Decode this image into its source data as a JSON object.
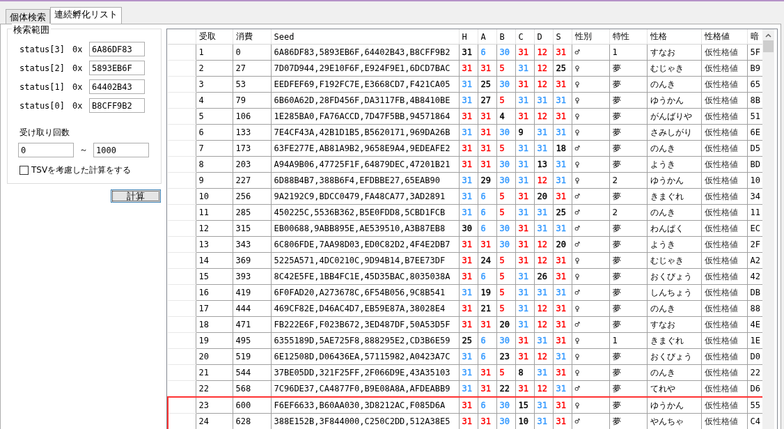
{
  "tabs": [
    {
      "label": "個体検索",
      "selected": false
    },
    {
      "label": "連続孵化リスト",
      "selected": true
    }
  ],
  "search_range": {
    "title": "検索範囲",
    "status_fields": [
      {
        "label": "status[3]",
        "prefix": "0x",
        "value": "6A86DF83"
      },
      {
        "label": "status[2]",
        "prefix": "0x",
        "value": "5893EB6F"
      },
      {
        "label": "status[1]",
        "prefix": "0x",
        "value": "64402B43"
      },
      {
        "label": "status[0]",
        "prefix": "0x",
        "value": "B8CFF9B2"
      }
    ],
    "count_label": "受け取り回数",
    "range_from": "0",
    "range_separator": "～",
    "range_to": "1000",
    "tsv_checkbox": {
      "label": "TSVを考慮した計算をする",
      "checked": false
    }
  },
  "calculate_button": "計算",
  "table": {
    "columns": [
      "受取",
      "消費",
      "Seed",
      "H",
      "A",
      "B",
      "C",
      "D",
      "S",
      "性別",
      "特性",
      "性格",
      "性格値",
      "暗"
    ],
    "rows": [
      {
        "receive": "1",
        "consume": "0",
        "seed": "6A86DF83,5893EB6F,64402B43,B8CFF9B2",
        "ivs": [
          {
            "value": "31",
            "color": "#000000"
          },
          {
            "value": "6",
            "color": "#3399ff"
          },
          {
            "value": "30",
            "color": "#3399ff"
          },
          {
            "value": "31",
            "color": "#ff0000"
          },
          {
            "value": "12",
            "color": "#ff0000"
          },
          {
            "value": "31",
            "color": "#ff0000"
          }
        ],
        "gender": "♂",
        "ability": "1",
        "nature": "すなお",
        "pid": "仮性格値",
        "column_14": "5F",
        "marked": false
      },
      {
        "receive": "2",
        "consume": "27",
        "seed": "7D07D944,29E10F6F,E924F9E1,6DCD7BAC",
        "ivs": [
          {
            "value": "31",
            "color": "#ff0000"
          },
          {
            "value": "31",
            "color": "#ff0000"
          },
          {
            "value": "5",
            "color": "#ff0000"
          },
          {
            "value": "31",
            "color": "#3399ff"
          },
          {
            "value": "12",
            "color": "#ff0000"
          },
          {
            "value": "25",
            "color": "#000000"
          }
        ],
        "gender": "♀",
        "ability": "夢",
        "nature": "むじゃき",
        "pid": "仮性格値",
        "column_14": "B9",
        "marked": false
      },
      {
        "receive": "3",
        "consume": "53",
        "seed": "EEDFEF69,F192FC7E,E3668CD7,F421CA05",
        "ivs": [
          {
            "value": "31",
            "color": "#3399ff"
          },
          {
            "value": "25",
            "color": "#000000"
          },
          {
            "value": "30",
            "color": "#3399ff"
          },
          {
            "value": "31",
            "color": "#ff0000"
          },
          {
            "value": "12",
            "color": "#ff0000"
          },
          {
            "value": "31",
            "color": "#ff0000"
          }
        ],
        "gender": "♀",
        "ability": "夢",
        "nature": "のんき",
        "pid": "仮性格値",
        "column_14": "65",
        "marked": false
      },
      {
        "receive": "4",
        "consume": "79",
        "seed": "6B60A62D,28FD456F,DA3117FB,4B8410BE",
        "ivs": [
          {
            "value": "31",
            "color": "#3399ff"
          },
          {
            "value": "27",
            "color": "#000000"
          },
          {
            "value": "5",
            "color": "#ff0000"
          },
          {
            "value": "31",
            "color": "#3399ff"
          },
          {
            "value": "31",
            "color": "#3399ff"
          },
          {
            "value": "31",
            "color": "#3399ff"
          }
        ],
        "gender": "♀",
        "ability": "夢",
        "nature": "ゆうかん",
        "pid": "仮性格値",
        "column_14": "8B",
        "marked": false
      },
      {
        "receive": "5",
        "consume": "106",
        "seed": "1E285BA0,FA76ACCD,7D47F5BB,94571864",
        "ivs": [
          {
            "value": "31",
            "color": "#ff0000"
          },
          {
            "value": "31",
            "color": "#ff0000"
          },
          {
            "value": "4",
            "color": "#000000"
          },
          {
            "value": "31",
            "color": "#ff0000"
          },
          {
            "value": "12",
            "color": "#ff0000"
          },
          {
            "value": "31",
            "color": "#ff0000"
          }
        ],
        "gender": "♀",
        "ability": "夢",
        "nature": "がんばりや",
        "pid": "仮性格値",
        "column_14": "51",
        "marked": false
      },
      {
        "receive": "6",
        "consume": "133",
        "seed": "7E4CF43A,42B1D1B5,B5620171,969DA26B",
        "ivs": [
          {
            "value": "31",
            "color": "#3399ff"
          },
          {
            "value": "31",
            "color": "#ff0000"
          },
          {
            "value": "30",
            "color": "#3399ff"
          },
          {
            "value": "9",
            "color": "#000000"
          },
          {
            "value": "31",
            "color": "#3399ff"
          },
          {
            "value": "31",
            "color": "#3399ff"
          }
        ],
        "gender": "♀",
        "ability": "夢",
        "nature": "さみしがり",
        "pid": "仮性格値",
        "column_14": "6E",
        "marked": false
      },
      {
        "receive": "7",
        "consume": "173",
        "seed": "63FE277E,AB81A9B2,9658E9A4,9EDEAFE2",
        "ivs": [
          {
            "value": "31",
            "color": "#ff0000"
          },
          {
            "value": "31",
            "color": "#ff0000"
          },
          {
            "value": "5",
            "color": "#ff0000"
          },
          {
            "value": "31",
            "color": "#3399ff"
          },
          {
            "value": "31",
            "color": "#3399ff"
          },
          {
            "value": "18",
            "color": "#000000"
          }
        ],
        "gender": "♂",
        "ability": "夢",
        "nature": "のんき",
        "pid": "仮性格値",
        "column_14": "D5",
        "marked": false
      },
      {
        "receive": "8",
        "consume": "203",
        "seed": "A94A9B06,47725F1F,64879DEC,47201B21",
        "ivs": [
          {
            "value": "31",
            "color": "#ff0000"
          },
          {
            "value": "31",
            "color": "#ff0000"
          },
          {
            "value": "30",
            "color": "#3399ff"
          },
          {
            "value": "31",
            "color": "#3399ff"
          },
          {
            "value": "13",
            "color": "#000000"
          },
          {
            "value": "31",
            "color": "#3399ff"
          }
        ],
        "gender": "♀",
        "ability": "夢",
        "nature": "ようき",
        "pid": "仮性格値",
        "column_14": "BD",
        "marked": false
      },
      {
        "receive": "9",
        "consume": "227",
        "seed": "6D88B4B7,388B6F4,EFDBBE27,65EAB90",
        "ivs": [
          {
            "value": "31",
            "color": "#3399ff"
          },
          {
            "value": "29",
            "color": "#000000"
          },
          {
            "value": "30",
            "color": "#3399ff"
          },
          {
            "value": "31",
            "color": "#3399ff"
          },
          {
            "value": "12",
            "color": "#ff0000"
          },
          {
            "value": "31",
            "color": "#3399ff"
          }
        ],
        "gender": "♀",
        "ability": "2",
        "nature": "ゆうかん",
        "pid": "仮性格値",
        "column_14": "10",
        "marked": false
      },
      {
        "receive": "10",
        "consume": "256",
        "seed": "9A2192C9,BDCC0479,FA48CA77,3AD2891",
        "ivs": [
          {
            "value": "31",
            "color": "#3399ff"
          },
          {
            "value": "6",
            "color": "#3399ff"
          },
          {
            "value": "5",
            "color": "#ff0000"
          },
          {
            "value": "31",
            "color": "#ff0000"
          },
          {
            "value": "20",
            "color": "#000000"
          },
          {
            "value": "31",
            "color": "#ff0000"
          }
        ],
        "gender": "♂",
        "ability": "夢",
        "nature": "きまぐれ",
        "pid": "仮性格値",
        "column_14": "34",
        "marked": false
      },
      {
        "receive": "11",
        "consume": "285",
        "seed": "450225C,5536B362,B5E0FDD8,5CBD1FCB",
        "ivs": [
          {
            "value": "31",
            "color": "#3399ff"
          },
          {
            "value": "6",
            "color": "#3399ff"
          },
          {
            "value": "5",
            "color": "#ff0000"
          },
          {
            "value": "31",
            "color": "#3399ff"
          },
          {
            "value": "31",
            "color": "#3399ff"
          },
          {
            "value": "25",
            "color": "#000000"
          }
        ],
        "gender": "♂",
        "ability": "2",
        "nature": "のんき",
        "pid": "仮性格値",
        "column_14": "11",
        "marked": false
      },
      {
        "receive": "12",
        "consume": "315",
        "seed": "EB00688,9ABB895E,AE539510,A3B87EB8",
        "ivs": [
          {
            "value": "30",
            "color": "#000000"
          },
          {
            "value": "6",
            "color": "#3399ff"
          },
          {
            "value": "30",
            "color": "#3399ff"
          },
          {
            "value": "31",
            "color": "#ff0000"
          },
          {
            "value": "31",
            "color": "#3399ff"
          },
          {
            "value": "31",
            "color": "#3399ff"
          }
        ],
        "gender": "♂",
        "ability": "夢",
        "nature": "わんぱく",
        "pid": "仮性格値",
        "column_14": "EC",
        "marked": false
      },
      {
        "receive": "13",
        "consume": "343",
        "seed": "6C806FDE,7AA98D03,ED0C82D2,4F4E2DB7",
        "ivs": [
          {
            "value": "31",
            "color": "#ff0000"
          },
          {
            "value": "31",
            "color": "#ff0000"
          },
          {
            "value": "30",
            "color": "#3399ff"
          },
          {
            "value": "31",
            "color": "#ff0000"
          },
          {
            "value": "12",
            "color": "#ff0000"
          },
          {
            "value": "20",
            "color": "#000000"
          }
        ],
        "gender": "♂",
        "ability": "夢",
        "nature": "ようき",
        "pid": "仮性格値",
        "column_14": "2F",
        "marked": false
      },
      {
        "receive": "14",
        "consume": "369",
        "seed": "5225A571,4DC0210C,9D94B14,B7EE73DF",
        "ivs": [
          {
            "value": "31",
            "color": "#ff0000"
          },
          {
            "value": "24",
            "color": "#000000"
          },
          {
            "value": "5",
            "color": "#ff0000"
          },
          {
            "value": "31",
            "color": "#ff0000"
          },
          {
            "value": "12",
            "color": "#ff0000"
          },
          {
            "value": "31",
            "color": "#ff0000"
          }
        ],
        "gender": "♀",
        "ability": "夢",
        "nature": "むじゃき",
        "pid": "仮性格値",
        "column_14": "A2",
        "marked": false
      },
      {
        "receive": "15",
        "consume": "393",
        "seed": "8C42E5FE,1BB4FC1E,45D35BAC,8035038A",
        "ivs": [
          {
            "value": "31",
            "color": "#ff0000"
          },
          {
            "value": "6",
            "color": "#3399ff"
          },
          {
            "value": "5",
            "color": "#ff0000"
          },
          {
            "value": "31",
            "color": "#3399ff"
          },
          {
            "value": "26",
            "color": "#000000"
          },
          {
            "value": "31",
            "color": "#ff0000"
          }
        ],
        "gender": "♀",
        "ability": "夢",
        "nature": "おくびょう",
        "pid": "仮性格値",
        "column_14": "42",
        "marked": false
      },
      {
        "receive": "16",
        "consume": "419",
        "seed": "6F0FAD20,A273678C,6F54B056,9C8B541",
        "ivs": [
          {
            "value": "31",
            "color": "#3399ff"
          },
          {
            "value": "19",
            "color": "#000000"
          },
          {
            "value": "5",
            "color": "#ff0000"
          },
          {
            "value": "31",
            "color": "#3399ff"
          },
          {
            "value": "31",
            "color": "#3399ff"
          },
          {
            "value": "31",
            "color": "#3399ff"
          }
        ],
        "gender": "♂",
        "ability": "夢",
        "nature": "しんちょう",
        "pid": "仮性格値",
        "column_14": "DB",
        "marked": false
      },
      {
        "receive": "17",
        "consume": "444",
        "seed": "469CF82E,D46AC4D7,EB59E87A,38028E4",
        "ivs": [
          {
            "value": "31",
            "color": "#ff0000"
          },
          {
            "value": "21",
            "color": "#000000"
          },
          {
            "value": "5",
            "color": "#ff0000"
          },
          {
            "value": "31",
            "color": "#3399ff"
          },
          {
            "value": "12",
            "color": "#ff0000"
          },
          {
            "value": "31",
            "color": "#ff0000"
          }
        ],
        "gender": "♀",
        "ability": "夢",
        "nature": "のんき",
        "pid": "仮性格値",
        "column_14": "88",
        "marked": false
      },
      {
        "receive": "18",
        "consume": "471",
        "seed": "FB222E6F,F023B672,3ED487DF,50A53D5F",
        "ivs": [
          {
            "value": "31",
            "color": "#ff0000"
          },
          {
            "value": "31",
            "color": "#ff0000"
          },
          {
            "value": "20",
            "color": "#000000"
          },
          {
            "value": "31",
            "color": "#3399ff"
          },
          {
            "value": "12",
            "color": "#ff0000"
          },
          {
            "value": "31",
            "color": "#ff0000"
          }
        ],
        "gender": "♂",
        "ability": "夢",
        "nature": "すなお",
        "pid": "仮性格値",
        "column_14": "4E",
        "marked": false
      },
      {
        "receive": "19",
        "consume": "495",
        "seed": "6355189D,5AE725F8,888295E2,CD3B6E59",
        "ivs": [
          {
            "value": "25",
            "color": "#000000"
          },
          {
            "value": "6",
            "color": "#3399ff"
          },
          {
            "value": "30",
            "color": "#3399ff"
          },
          {
            "value": "31",
            "color": "#ff0000"
          },
          {
            "value": "31",
            "color": "#3399ff"
          },
          {
            "value": "31",
            "color": "#ff0000"
          }
        ],
        "gender": "♀",
        "ability": "1",
        "nature": "きまぐれ",
        "pid": "仮性格値",
        "column_14": "1E",
        "marked": false
      },
      {
        "receive": "20",
        "consume": "519",
        "seed": "6E12508D,D06436EA,57115982,A0423A7C",
        "ivs": [
          {
            "value": "31",
            "color": "#3399ff"
          },
          {
            "value": "6",
            "color": "#3399ff"
          },
          {
            "value": "23",
            "color": "#000000"
          },
          {
            "value": "31",
            "color": "#ff0000"
          },
          {
            "value": "12",
            "color": "#ff0000"
          },
          {
            "value": "31",
            "color": "#3399ff"
          }
        ],
        "gender": "♀",
        "ability": "夢",
        "nature": "おくびょう",
        "pid": "仮性格値",
        "column_14": "D0",
        "marked": false
      },
      {
        "receive": "21",
        "consume": "544",
        "seed": "37BE05DD,321F25FF,2F066D9E,43A35103",
        "ivs": [
          {
            "value": "31",
            "color": "#3399ff"
          },
          {
            "value": "31",
            "color": "#ff0000"
          },
          {
            "value": "5",
            "color": "#ff0000"
          },
          {
            "value": "8",
            "color": "#000000"
          },
          {
            "value": "31",
            "color": "#3399ff"
          },
          {
            "value": "31",
            "color": "#ff0000"
          }
        ],
        "gender": "♀",
        "ability": "夢",
        "nature": "のんき",
        "pid": "仮性格値",
        "column_14": "22",
        "marked": false
      },
      {
        "receive": "22",
        "consume": "568",
        "seed": "7C96DE37,CA4877F0,B9E08A8A,AFDEABB9",
        "ivs": [
          {
            "value": "31",
            "color": "#3399ff"
          },
          {
            "value": "31",
            "color": "#ff0000"
          },
          {
            "value": "22",
            "color": "#000000"
          },
          {
            "value": "31",
            "color": "#ff0000"
          },
          {
            "value": "12",
            "color": "#ff0000"
          },
          {
            "value": "31",
            "color": "#3399ff"
          }
        ],
        "gender": "♂",
        "ability": "夢",
        "nature": "てれや",
        "pid": "仮性格値",
        "column_14": "D6",
        "marked": false
      },
      {
        "receive": "23",
        "consume": "600",
        "seed": "F6EF6633,B60AA030,3D8212AC,F085D6A",
        "ivs": [
          {
            "value": "31",
            "color": "#ff0000"
          },
          {
            "value": "6",
            "color": "#3399ff"
          },
          {
            "value": "30",
            "color": "#3399ff"
          },
          {
            "value": "15",
            "color": "#000000"
          },
          {
            "value": "31",
            "color": "#3399ff"
          },
          {
            "value": "31",
            "color": "#ff0000"
          }
        ],
        "gender": "♀",
        "ability": "夢",
        "nature": "ゆうかん",
        "pid": "仮性格値",
        "column_14": "55",
        "marked": true
      },
      {
        "receive": "24",
        "consume": "628",
        "seed": "388E152B,3F844000,C250C2DD,512A38E5",
        "ivs": [
          {
            "value": "31",
            "color": "#ff0000"
          },
          {
            "value": "31",
            "color": "#ff0000"
          },
          {
            "value": "30",
            "color": "#3399ff"
          },
          {
            "value": "10",
            "color": "#000000"
          },
          {
            "value": "31",
            "color": "#3399ff"
          },
          {
            "value": "31",
            "color": "#ff0000"
          }
        ],
        "gender": "♂",
        "ability": "夢",
        "nature": "やんちゃ",
        "pid": "仮性格値",
        "column_14": "C4",
        "marked": true
      }
    ]
  }
}
